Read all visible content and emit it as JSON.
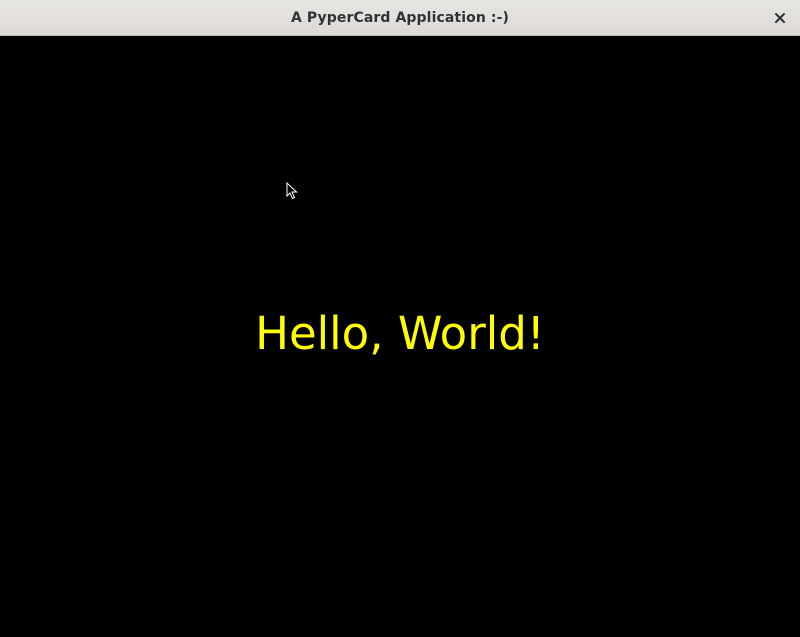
{
  "window": {
    "title": "A PyperCard Application :-)",
    "close_icon": "close-icon"
  },
  "card": {
    "message": "Hello, World!",
    "text_color": "#ffff00",
    "background_color": "#000000"
  }
}
